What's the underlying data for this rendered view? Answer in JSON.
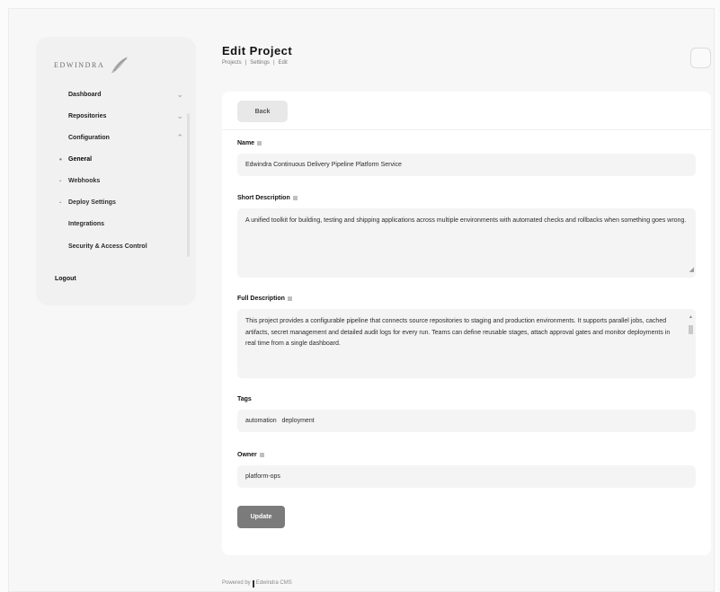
{
  "sidebar": {
    "brand": "EDWINDRA",
    "items": [
      {
        "label": "Dashboard",
        "chevron": "⌄"
      },
      {
        "label": "Repositories",
        "chevron": "⌄"
      },
      {
        "label": "Configuration",
        "chevron": "⌃"
      }
    ],
    "sub_items": [
      {
        "label": "General",
        "bullet": "•"
      },
      {
        "label": "Webhooks",
        "bullet": "·"
      },
      {
        "label": "Deploy Settings",
        "bullet": "·"
      }
    ],
    "plain_items": [
      "Integrations",
      "Security & Access Control"
    ],
    "sign_out": "Logout"
  },
  "header": {
    "title": "Edit Project",
    "breadcrumb": [
      "Projects",
      "Settings",
      "Edit"
    ]
  },
  "form": {
    "back_label": "Back",
    "name_label": "Name",
    "name_value": "Edwindra Continuous Delivery Pipeline Platform Service",
    "desc_label": "Short Description",
    "desc_value": "A unified toolkit for building, testing and shipping applications across multiple environments with automated checks and rollbacks when something goes wrong.",
    "details_label": "Full Description",
    "details_value": "This project provides a configurable pipeline that connects source repositories to staging and production environments. It supports parallel jobs, cached artifacts, secret management and detailed audit logs for every run. Teams can define reusable stages, attach approval gates and monitor deployments in real time from a single dashboard.",
    "tags_label": "Tags",
    "tags_value": "automation   deployment",
    "owner_label": "Owner",
    "owner_value": "platform-ops",
    "submit_label": "Update"
  },
  "footer": {
    "left": "Powered by",
    "right": "Edwindra CMS"
  },
  "icons": {
    "resize": "resize-handle-icon",
    "scroll_up": "▲",
    "scroll_down": "▼",
    "resize_glyph": "◢"
  }
}
